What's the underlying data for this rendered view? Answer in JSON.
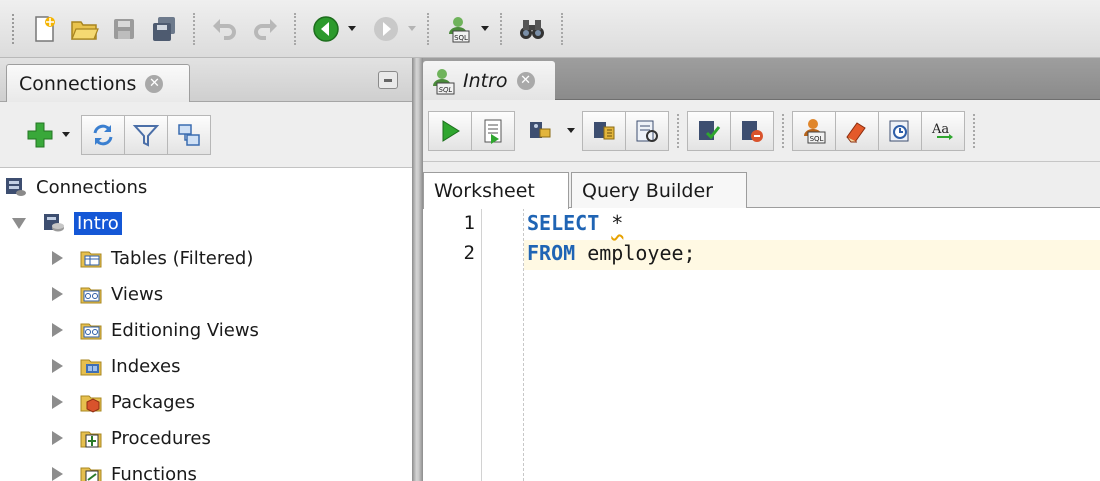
{
  "main_toolbar": {
    "buttons": [
      "new-icon",
      "open-folder-icon",
      "save-icon",
      "save-all-icon",
      "undo-icon",
      "redo-icon",
      "back-icon",
      "forward-icon",
      "sql-worksheet-icon",
      "binoculars-icon"
    ]
  },
  "connections_panel": {
    "tab_label": "Connections",
    "close_glyph": "✕",
    "toolbar": [
      "add-connection-icon",
      "refresh-icon",
      "filter-icon",
      "schema-browser-icon"
    ],
    "tree": {
      "root_label": "Connections",
      "connection_label": "Intro",
      "items": [
        {
          "label": "Tables (Filtered)",
          "icon": "table-folder-icon"
        },
        {
          "label": "Views",
          "icon": "views-folder-icon"
        },
        {
          "label": "Editioning Views",
          "icon": "editioning-views-folder-icon"
        },
        {
          "label": "Indexes",
          "icon": "indexes-folder-icon"
        },
        {
          "label": "Packages",
          "icon": "packages-folder-icon"
        },
        {
          "label": "Procedures",
          "icon": "procedures-folder-icon"
        },
        {
          "label": "Functions",
          "icon": "functions-folder-icon"
        }
      ]
    }
  },
  "editor_panel": {
    "tab_label": "Intro",
    "close_glyph": "✕",
    "subtabs": [
      "Worksheet",
      "Query Builder"
    ],
    "active_subtab": "Worksheet",
    "lines": [
      {
        "number": "1",
        "keyword": "SELECT",
        "rest": " ",
        "squiggle": "*"
      },
      {
        "number": "2",
        "keyword": "FROM",
        "rest": " employee;",
        "squiggle": ""
      }
    ]
  },
  "colors": {
    "selection": "#1457d6",
    "keyword": "#1f64b4",
    "current_line": "#fff9e3",
    "run_green": "#2fa62f"
  }
}
